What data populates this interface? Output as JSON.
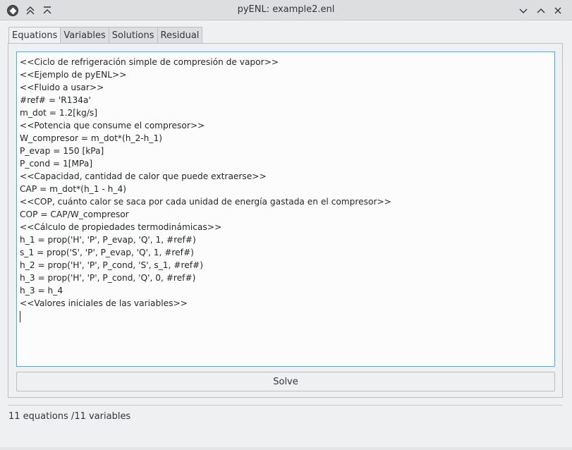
{
  "window": {
    "title": "pyENL: example2.enl"
  },
  "tabs": [
    {
      "label": "Equations",
      "active": true
    },
    {
      "label": "Variables",
      "active": false
    },
    {
      "label": "Solutions",
      "active": false
    },
    {
      "label": "Residual",
      "active": false
    }
  ],
  "editor": {
    "lines": [
      "<<Ciclo de refrigeración simple de compresión de vapor>>",
      "<<Ejemplo de pyENL>>",
      "<<Fluido a usar>>",
      "#ref# = 'R134a'",
      "m_dot = 1.2[kg/s]",
      "<<Potencia que consume el compresor>>",
      "W_compresor = m_dot*(h_2-h_1)",
      "P_evap = 150 [kPa]",
      "P_cond = 1[MPa]",
      "<<Capacidad, cantidad de calor que puede extraerse>>",
      "CAP = m_dot*(h_1 - h_4)",
      "<<COP, cuánto calor se saca por cada unidad de energía gastada en el compresor>>",
      "COP = CAP/W_compresor",
      "<<Cálculo de propiedades termodinámicas>>",
      "h_1 = prop('H', 'P', P_evap, 'Q', 1, #ref#)",
      "s_1 = prop('S', 'P', P_evap, 'Q', 1, #ref#)",
      "h_2 = prop('H', 'P', P_cond, 'S', s_1, #ref#)",
      "h_3 = prop('H', 'P', P_cond, 'Q', 0, #ref#)",
      "h_3 = h_4",
      "<<Valores iniciales de las variables>>"
    ]
  },
  "solve_button": {
    "label": "Solve"
  },
  "status": {
    "text": "11 equations /11 variables"
  },
  "icons": {
    "app": "app-diamond-icon",
    "keep_above": "double-chevron-up-icon",
    "keep_below": "chevron-up-bar-icon",
    "minimize": "chevron-down-icon",
    "maximize": "chevron-up-icon",
    "close": "close-icon"
  },
  "colors": {
    "accent": "#3daee9",
    "background": "#eff0f1",
    "titlebar": "#dcdedf"
  }
}
